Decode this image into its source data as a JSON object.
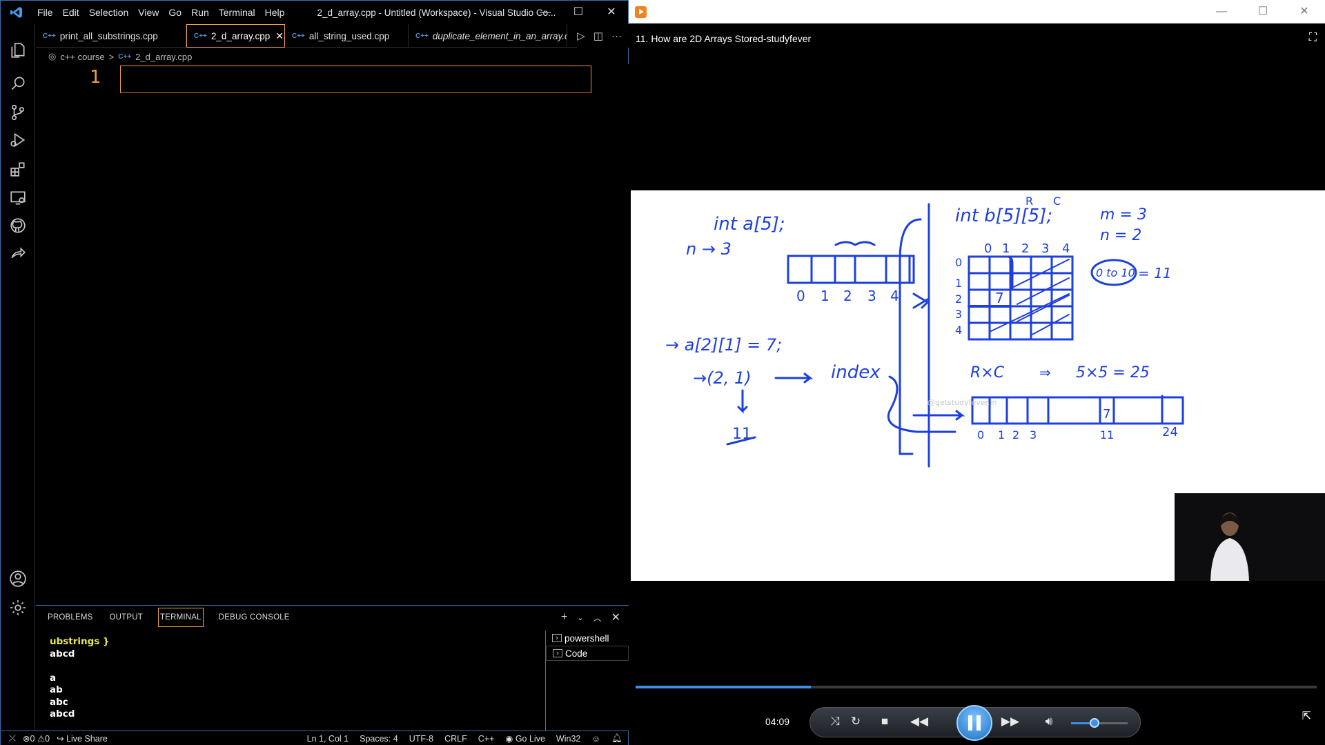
{
  "vscode": {
    "menu": [
      "File",
      "Edit",
      "Selection",
      "View",
      "Go",
      "Run",
      "Terminal",
      "Help"
    ],
    "window_title": "2_d_array.cpp - Untitled (Workspace) - Visual Studio Co...",
    "tabs": [
      {
        "label": "print_all_substrings.cpp",
        "icon": "C++"
      },
      {
        "label": "2_d_array.cpp",
        "icon": "C++"
      },
      {
        "label": "all_string_used.cpp",
        "icon": "C++"
      },
      {
        "label": "duplicate_element_in_an_array.cp",
        "icon": "C++"
      }
    ],
    "breadcrumb": {
      "folder": "c++ course",
      "separator": ">",
      "file": "2_d_array.cpp",
      "file_icon": "C++"
    },
    "editor": {
      "line_number": "1"
    },
    "panel_tabs": [
      "PROBLEMS",
      "OUTPUT",
      "TERMINAL",
      "DEBUG CONSOLE"
    ],
    "terminal_lines": [
      "ubstrings }",
      "abcd",
      "",
      "a",
      "ab",
      "abc",
      "abcd"
    ],
    "terminal_list": [
      "powershell",
      "Code"
    ],
    "status": {
      "errors": "0",
      "warnings": "0",
      "live_share": "Live Share",
      "position": "Ln 1, Col 1",
      "spaces": "Spaces: 4",
      "encoding": "UTF-8",
      "eol": "CRLF",
      "language": "C++",
      "go_live": "Go Live",
      "platform": "Win32"
    }
  },
  "player": {
    "video_title": "11. How are 2D Arrays Stored-studyfever",
    "time": "04:09",
    "progress_percent": 25.7,
    "volume_percent": 42,
    "whiteboard": {
      "decl_1d": "int a[5];",
      "n_1d": "n → 3",
      "indices_1d": [
        "0",
        "1",
        "2",
        "3",
        "4"
      ],
      "access": "→ a[2][1] = 7;",
      "pair": "→(2, 1)",
      "index_word": "index",
      "eleven": "11",
      "decl_2d": "int b[5][5];",
      "rc_labels": [
        "R",
        "C"
      ],
      "m_eq": "m = 3",
      "n_eq": "n = 2",
      "col_idx": [
        "0",
        "1",
        "2",
        "3",
        "4"
      ],
      "row_idx": [
        "0",
        "1",
        "2",
        "3",
        "4"
      ],
      "cell_value": "7",
      "range": "0 to 10",
      "range_result": "= 11",
      "rxc": "R×C",
      "rxc_sep": "⇒",
      "rxc_eval": "5×5 = 25",
      "flat_idx": [
        "0",
        "1",
        "2",
        "3",
        "11",
        "24"
      ],
      "watermark": "@getstudyfever.in"
    }
  }
}
